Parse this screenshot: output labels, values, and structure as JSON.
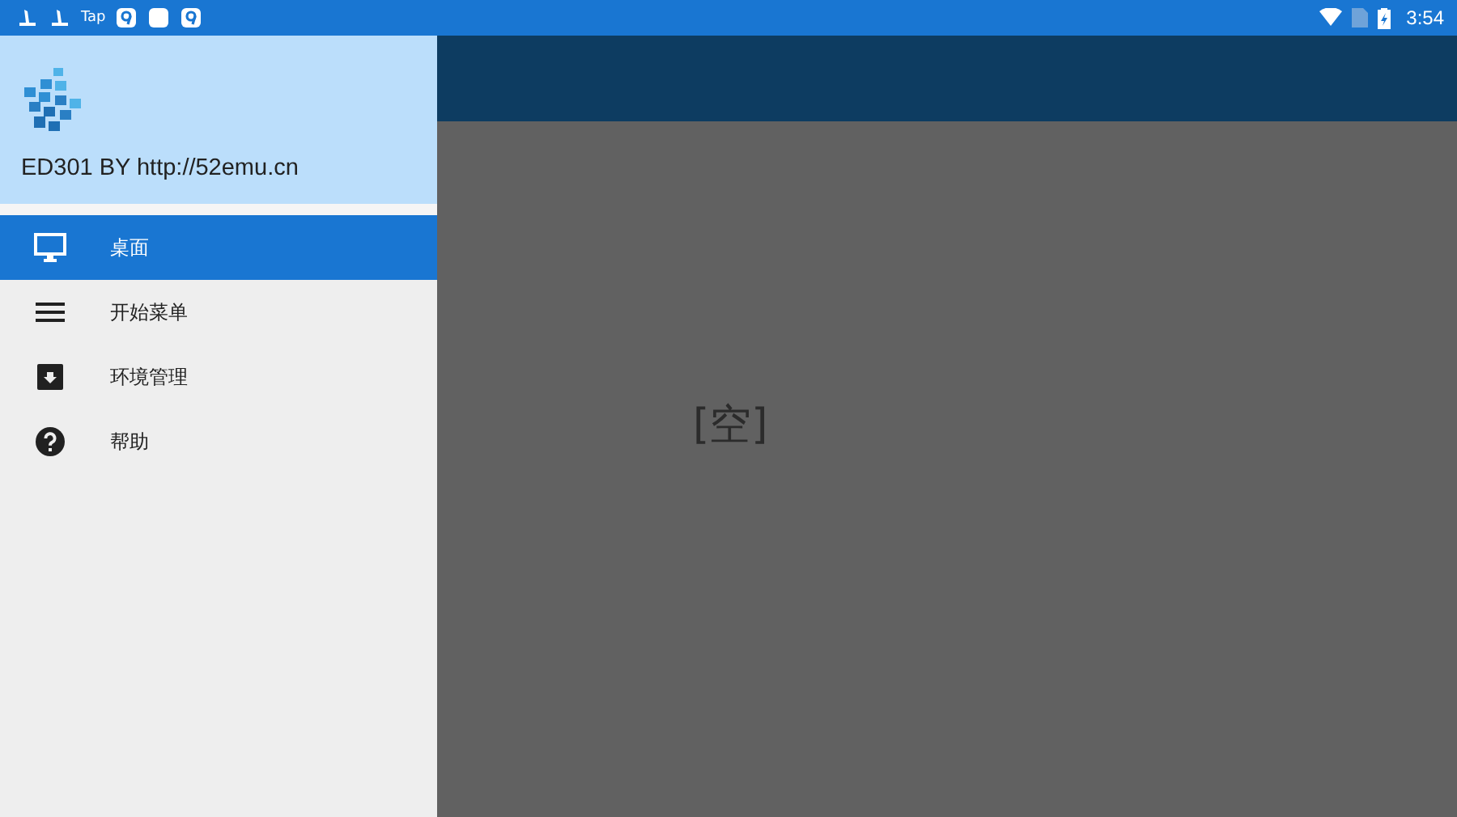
{
  "status_bar": {
    "left_text": "Tap",
    "time": "3:54"
  },
  "drawer": {
    "header_title": "ED301 BY http://52emu.cn",
    "items": [
      {
        "label": "桌面",
        "kind": "monitor",
        "selected": true
      },
      {
        "label": "开始菜单",
        "kind": "menu",
        "selected": false
      },
      {
        "label": "环境管理",
        "kind": "box",
        "selected": false
      },
      {
        "label": "帮助",
        "kind": "help",
        "selected": false
      }
    ]
  },
  "content": {
    "empty_text": "[空]"
  }
}
